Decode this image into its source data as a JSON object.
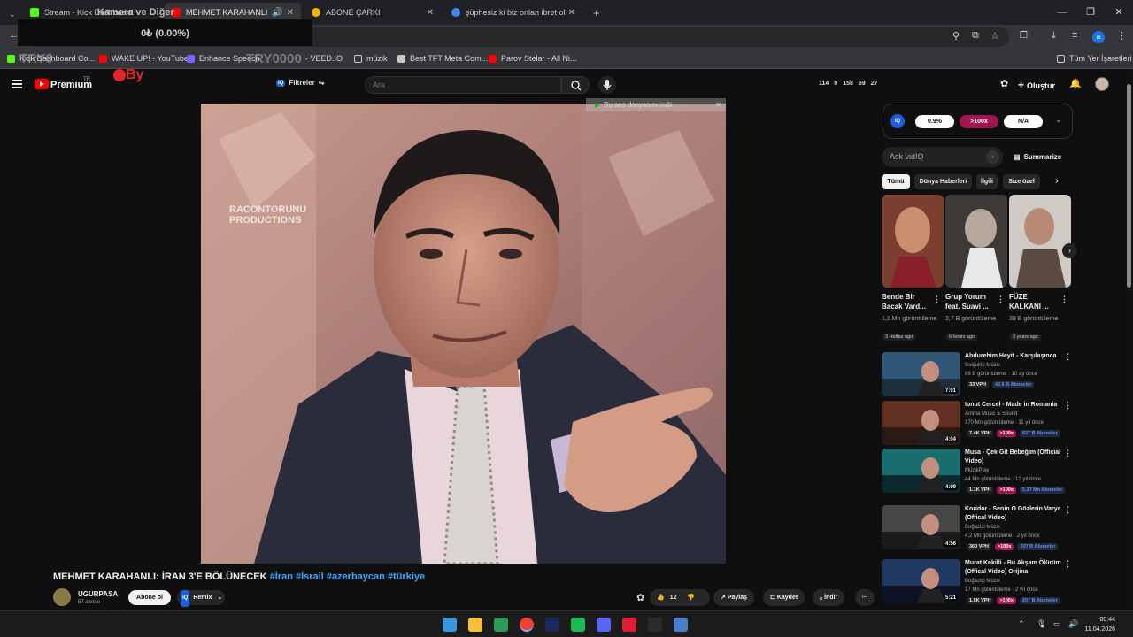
{
  "browser": {
    "tabs": [
      {
        "title": "Stream - Kick Dashboard",
        "color": "#53fc18"
      },
      {
        "title": "MEHMET KARAHANLI: İRAN",
        "color": "#ff0000"
      },
      {
        "title": "ABONE ÇARKI",
        "color": "#f4b400"
      },
      {
        "title": "şüphesiz ki biz onlan ibret olsun",
        "color": "#4285f4"
      }
    ],
    "new_tab": "+",
    "bookmarks": [
      {
        "label": "Kick Dashboard Co...",
        "color": "#53fc18"
      },
      {
        "label": "WAKE UP! - YouTube",
        "color": "#ff0000"
      },
      {
        "label": "Enhance Speech",
        "color": "#7b61ff"
      },
      {
        "label": "- VEED.IO",
        "color": "#c7c7c7"
      },
      {
        "label": "müzik",
        "color": "#c7c7c7"
      },
      {
        "label": "Best TFT Meta Com...",
        "color": "#c7c7c7"
      },
      {
        "label": "Parov Stelar - All Ni...",
        "color": "#ff0000"
      }
    ],
    "all_bookmarks": "Tüm Yer İşaretleri",
    "profile_letter": "a"
  },
  "overlay": {
    "kamera_label": "Kamera ve Diğer",
    "balance": "0₺ (0.00%)",
    "watermark_left": "TRY0",
    "watermark_right": "TRY0000",
    "stamp": "By"
  },
  "youtube": {
    "brand": "Premium",
    "country": "TR",
    "filter_label": "Filtreler",
    "search_placeholder": "Ara",
    "stats": [
      "114",
      "0",
      "158",
      "69",
      "27"
    ],
    "create_label": "Oluştur"
  },
  "video": {
    "tooltip": "Bu ses dosyasını indir",
    "watermark_line1": "RACONTORUNU",
    "watermark_line2": "PRODUCTIONS",
    "title": "MEHMET KARAHANLI: İRAN 3'E BÖLÜNECEK",
    "hashtags": "#İran #İsrail #azerbaycan #türkiye",
    "channel": "UGURPASA",
    "subscribers": "57 abone",
    "subscribe_label": "Abone ol",
    "remix_label": "Remix",
    "likes": "12",
    "share_label": "Paylaş",
    "save_label": "Kaydet",
    "download_label": "İndir"
  },
  "vidiq": {
    "score": "0.9%",
    "views_badge": ">100x",
    "na": "N/A",
    "ask_placeholder": "Ask vidIQ",
    "summarize": "Summarize"
  },
  "chips": [
    "Tümü",
    "Dünya Haberleri",
    "İlgili",
    "Size özel"
  ],
  "shorts": [
    {
      "title": "Bende Bir Bacak Vard...",
      "views": "1,1 Mn görüntüleme",
      "age": "3 Haftas ago",
      "colors": [
        "#c98f6e",
        "#7a3f2e"
      ]
    },
    {
      "title": "Grup Yorum feat. Suavi ...",
      "views": "2,7 B görüntüleme",
      "age": "6 hours ago",
      "colors": [
        "#b5a79b",
        "#3d3a38"
      ]
    },
    {
      "title": "FÜZE KALKANI ...",
      "views": "39 B görüntüleme",
      "age": "3 years ago",
      "colors": [
        "#cfcac4",
        "#5a4a42"
      ]
    }
  ],
  "recommendations": [
    {
      "title": "Abdurehim Heyit - Karşılaşınca",
      "channel": "Selçuklu Müzik",
      "meta": "86 B görüntüleme · 10 ay önce",
      "duration": "7:01",
      "vph": "33 VPH",
      "hot": "",
      "subs": "42,6 B Aboneler",
      "colors": [
        "#3b6a8e",
        "#1d2e3c"
      ]
    },
    {
      "title": "Ionut Cercel - Made in Romania",
      "channel": "Amma Music & Sound",
      "meta": "170 Mn görüntüleme · 11 yıl önce",
      "duration": "4:04",
      "vph": "7.4K VPH",
      "hot": ">100x",
      "subs": "827 B Aboneler",
      "colors": [
        "#7a3a2a",
        "#2a1a14"
      ]
    },
    {
      "title": "Musa - Çek Git Bebeğim (Official Video)",
      "channel": "MüzikPlay",
      "meta": "44 Mn görüntüleme · 12 yıl önce",
      "duration": "4:09",
      "vph": "1.1K VPH",
      "hot": ">100x",
      "subs": "5,27 Mn Aboneler",
      "colors": [
        "#1e8a8a",
        "#0c2a2e"
      ]
    },
    {
      "title": "Koridor - Senin O Gözlerin Varya (Offical Video)",
      "channel": "Boğaziçi Müzik",
      "meta": "4,2 Mn görüntüleme · 2 yıl önce",
      "duration": "4:56",
      "vph": "360 VPH",
      "hot": ">100x",
      "subs": "207 B Aboneler",
      "colors": [
        "#5a5a5a",
        "#1a1a1a"
      ]
    },
    {
      "title": "Murat Kekilli - Bu Akşam Ölürüm (Offical Video) Orijinal",
      "channel": "Boğaziçi Müzik",
      "meta": "17 Mn görüntüleme · 2 yıl önce",
      "duration": "5:21",
      "vph": "1.5K VPH",
      "hot": ">100x",
      "subs": "207 B Aboneler",
      "colors": [
        "#2a4a7a",
        "#0c1224"
      ]
    }
  ],
  "taskbar": {
    "time": "00:44",
    "date": "11.04.2026",
    "apps": [
      "#3a96dd",
      "#f7c03a",
      "#2c9a5a",
      "#ea4335",
      "#1a2b5a",
      "#1db954",
      "#5865f2",
      "#e01e37",
      "#2a2a2a",
      "#4a7fc8"
    ]
  }
}
